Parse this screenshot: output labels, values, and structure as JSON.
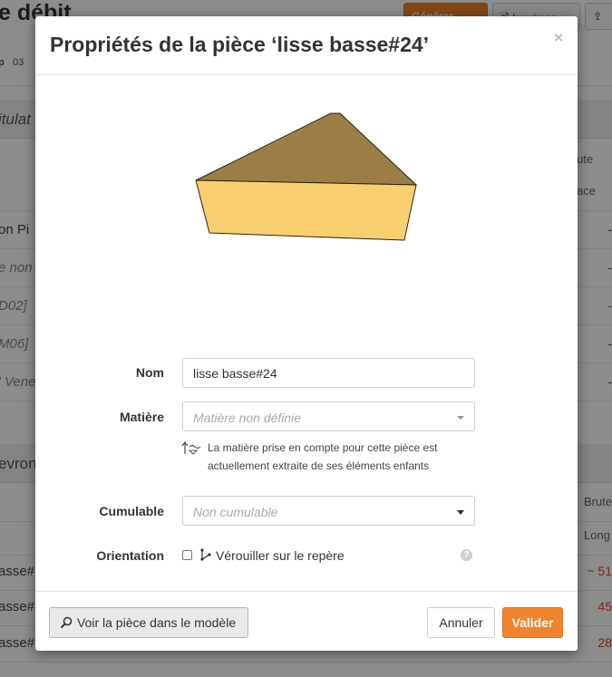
{
  "background": {
    "title": "e débit",
    "top_buttons": [
      "Générer",
      "Imprimer"
    ],
    "strip": [
      "p",
      "03"
    ],
    "section1": "itulat",
    "section2": "evron",
    "right_headers": [
      "ute",
      "ace",
      "Brute",
      "Long"
    ],
    "rows1": [
      "on Pi",
      "e non",
      "D02]",
      "M06]",
      "' Vene"
    ],
    "rows2": [
      "asse#",
      "asse#",
      "asse#"
    ],
    "rows2_values": [
      "~ 51",
      "45",
      "28"
    ]
  },
  "modal": {
    "title": "Propriétés de la pièce ‘lisse basse#24’",
    "close": "×",
    "fields": {
      "nom_label": "Nom",
      "nom_value": "lisse basse#24",
      "matiere_label": "Matière",
      "matiere_placeholder": "Matière non définie",
      "matiere_hint": "La matière prise en compte pour cette pièce est actuellement extraite de ses éléments enfants",
      "cumulable_label": "Cumulable",
      "cumulable_value": "Non cumulable",
      "orientation_label": "Orientation",
      "orientation_checkbox": "Vérouiller sur le repère",
      "help": "?"
    },
    "footer": {
      "view_button": "Voir la pièce dans le modèle",
      "cancel_button": "Annuler",
      "ok_button": "Valider"
    }
  },
  "colors": {
    "accent": "#f0832c",
    "piece_top": "#9a7e45",
    "piece_front": "#f9d06f",
    "red_value": "#e54b3c"
  }
}
